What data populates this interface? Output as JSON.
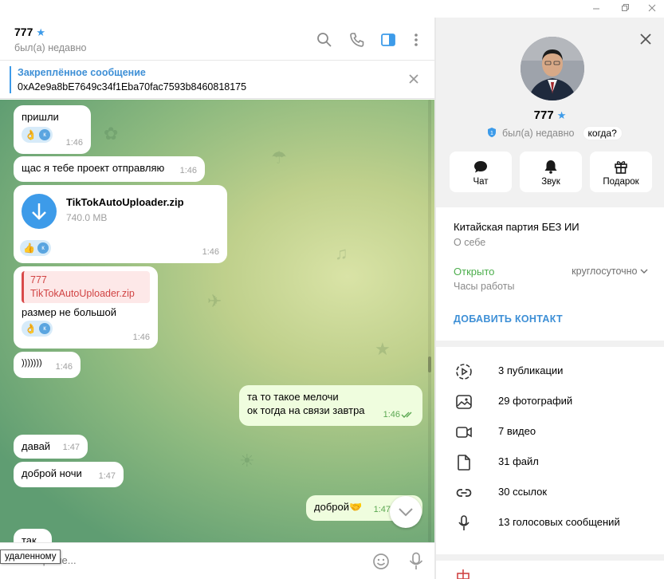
{
  "chat": {
    "title": "777",
    "status": "был(а) недавно"
  },
  "pinned": {
    "title": "Закреплённое сообщение",
    "text": "0xA2e9a8bE7649c34f1Eba70fac7593b8460818175"
  },
  "messages": [
    {
      "text": "пришли",
      "time": "1:46",
      "reaction": "👌",
      "reaction_user": "к"
    },
    {
      "text": "щас я тебе проект отправляю",
      "time": "1:46"
    },
    {
      "file_name": "TikTokAutoUploader.zip",
      "file_size": "740.0 MB",
      "time": "1:46",
      "reaction": "👍",
      "reaction_user": "к"
    },
    {
      "quote_author": "777",
      "quote_text": "TikTokAutoUploader.zip",
      "text": "размер не большой",
      "time": "1:46",
      "reaction": "👌",
      "reaction_user": "к"
    },
    {
      "text": ")))))))",
      "time": "1:46"
    },
    {
      "text_line1": "та то такое мелочи",
      "text_line2": "ок тогда на связи завтра",
      "time": "1:46"
    },
    {
      "text": "давай",
      "time": "1:47"
    },
    {
      "text": "доброй ночи",
      "time": "1:47"
    },
    {
      "text": "доброй🤝",
      "time": "1:47"
    },
    {
      "text": "так"
    }
  ],
  "composer": {
    "placeholder": "Сообщение..."
  },
  "tooltip": "удаленному",
  "profile": {
    "name": "777",
    "status": "был(а) недавно",
    "when_label": "когда?",
    "actions": [
      "Чат",
      "Звук",
      "Подарок"
    ],
    "bio": "Китайская партия БЕЗ ИИ",
    "bio_label": "О себе",
    "open_label": "Открыто",
    "hours_value": "круглосуточно",
    "hours_label": "Часы работы",
    "add_contact": "ДОБАВИТЬ КОНТАКТ",
    "media": [
      {
        "icon": "stories-icon",
        "label": "3 публикации"
      },
      {
        "icon": "photo-icon",
        "label": "29 фотографий"
      },
      {
        "icon": "video-icon",
        "label": "7 видео"
      },
      {
        "icon": "file-icon",
        "label": "31 файл"
      },
      {
        "icon": "link-icon",
        "label": "30 ссылок"
      },
      {
        "icon": "microphone-icon",
        "label": "13 голосовых сообщений"
      }
    ]
  },
  "colors": {
    "accent": "#3d9be9",
    "outgoing_bubble": "#effdde",
    "online_green": "#4cae4c",
    "quote_red": "#d14444"
  }
}
